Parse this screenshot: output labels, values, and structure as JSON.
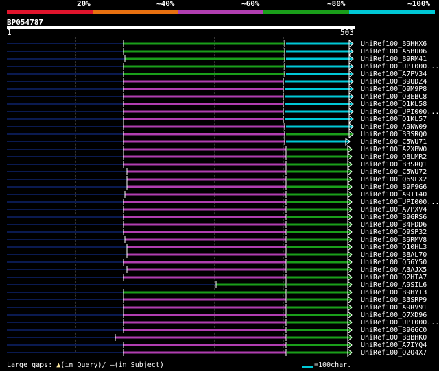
{
  "legend": {
    "colors": [
      "#e0142c",
      "#e87010",
      "#b03eb0",
      "#1a9e1a",
      "#00c8d6"
    ],
    "labels": [
      "20%",
      "~40%",
      "~60%",
      "~80%",
      "~100%"
    ]
  },
  "query": {
    "id": "BP054787",
    "start": "1",
    "end": "503"
  },
  "hits": [
    {
      "label": "UniRef100_B9HHX6",
      "start": 180,
      "mid": 415,
      "end": 515,
      "color": "#00c8d6"
    },
    {
      "label": "UniRef100_A5BU06",
      "start": 180,
      "mid": 415,
      "end": 515,
      "color": "#00c8d6"
    },
    {
      "label": "UniRef100_B9RM41",
      "start": 182,
      "mid": 415,
      "end": 515,
      "color": "#00c8d6"
    },
    {
      "label": "UniRef100_UPI000...",
      "start": 180,
      "mid": 415,
      "end": 515,
      "color": "#00c8d6"
    },
    {
      "label": "UniRef100_A7PV34",
      "start": 180,
      "mid": 415,
      "end": 515,
      "color": "#00c8d6"
    },
    {
      "label": "UniRef100_B9UDZ4",
      "start": 180,
      "mid": 413,
      "end": 515,
      "color": "#00c8d6",
      "mid_color": "#b03eb0"
    },
    {
      "label": "UniRef100_Q9M9P8",
      "start": 180,
      "mid": 413,
      "end": 515,
      "color": "#00c8d6",
      "mid_color": "#b03eb0"
    },
    {
      "label": "UniRef100_Q3EBC8",
      "start": 180,
      "mid": 413,
      "end": 515,
      "color": "#00c8d6",
      "mid_color": "#b03eb0"
    },
    {
      "label": "UniRef100_Q1KL58",
      "start": 180,
      "mid": 413,
      "end": 515,
      "color": "#00c8d6",
      "mid_color": "#b03eb0"
    },
    {
      "label": "UniRef100_UPI000...",
      "start": 180,
      "mid": 413,
      "end": 515,
      "color": "#00c8d6",
      "mid_color": "#b03eb0"
    },
    {
      "label": "UniRef100_Q1KL57",
      "start": 180,
      "mid": 413,
      "end": 515,
      "color": "#00c8d6",
      "mid_color": "#b03eb0"
    },
    {
      "label": "UniRef100_A9NW09",
      "start": 180,
      "mid": 415,
      "end": 515,
      "color": "#00c8d6",
      "mid_color": "#b03eb0"
    },
    {
      "label": "UniRef100_B3SRQ0",
      "start": 180,
      "mid": 415,
      "end": 515,
      "color": "#1a9e1a",
      "mid_color": "#b03eb0"
    },
    {
      "label": "UniRef100_C5WU71",
      "start": 180,
      "mid": 415,
      "end": 510,
      "color": "#00c8d6",
      "mid_color": "#b03eb0"
    },
    {
      "label": "UniRef100_A2XBW0",
      "start": 180,
      "mid": 417,
      "end": 513,
      "color": "#1a9e1a",
      "mid_color": "#b03eb0"
    },
    {
      "label": "UniRef100_Q8LMR2",
      "start": 180,
      "mid": 417,
      "end": 513,
      "color": "#1a9e1a",
      "mid_color": "#b03eb0"
    },
    {
      "label": "UniRef100_B3SRQ1",
      "start": 180,
      "mid": 417,
      "end": 513,
      "color": "#1a9e1a",
      "mid_color": "#b03eb0"
    },
    {
      "label": "UniRef100_C5WU72",
      "start": 185,
      "mid": 417,
      "end": 513,
      "color": "#1a9e1a",
      "mid_color": "#b03eb0"
    },
    {
      "label": "UniRef100_Q69LX2",
      "start": 185,
      "mid": 417,
      "end": 513,
      "color": "#1a9e1a",
      "mid_color": "#b03eb0"
    },
    {
      "label": "UniRef100_B9F9G6",
      "start": 185,
      "mid": 417,
      "end": 513,
      "color": "#1a9e1a",
      "mid_color": "#b03eb0"
    },
    {
      "label": "UniRef100_A9T140",
      "start": 182,
      "mid": 417,
      "end": 513,
      "color": "#1a9e1a",
      "mid_color": "#b03eb0"
    },
    {
      "label": "UniRef100_UPI000...",
      "start": 180,
      "mid": 417,
      "end": 513,
      "color": "#1a9e1a",
      "mid_color": "#b03eb0"
    },
    {
      "label": "UniRef100_A7PXV4",
      "start": 180,
      "mid": 417,
      "end": 513,
      "color": "#1a9e1a",
      "mid_color": "#b03eb0"
    },
    {
      "label": "UniRef100_B9GRS6",
      "start": 180,
      "mid": 417,
      "end": 513,
      "color": "#1a9e1a",
      "mid_color": "#b03eb0"
    },
    {
      "label": "UniRef100_B4FDD6",
      "start": 180,
      "mid": 417,
      "end": 513,
      "color": "#1a9e1a",
      "mid_color": "#b03eb0"
    },
    {
      "label": "UniRef100_Q9SP32",
      "start": 180,
      "mid": 417,
      "end": 513,
      "color": "#1a9e1a",
      "mid_color": "#b03eb0"
    },
    {
      "label": "UniRef100_B9RMV8",
      "start": 182,
      "mid": 417,
      "end": 513,
      "color": "#1a9e1a",
      "mid_color": "#b03eb0"
    },
    {
      "label": "UniRef100_Q10HL3",
      "start": 185,
      "mid": 417,
      "end": 513,
      "color": "#1a9e1a",
      "mid_color": "#b03eb0"
    },
    {
      "label": "UniRef100_B8AL70",
      "start": 185,
      "mid": 417,
      "end": 513,
      "color": "#1a9e1a",
      "mid_color": "#b03eb0"
    },
    {
      "label": "UniRef100_Q56Y50",
      "start": 180,
      "mid": 417,
      "end": 513,
      "color": "#1a9e1a",
      "mid_color": "#b03eb0"
    },
    {
      "label": "UniRef100_A3AJX5",
      "start": 185,
      "mid": 417,
      "end": 513,
      "color": "#1a9e1a",
      "mid_color": "#b03eb0"
    },
    {
      "label": "UniRef100_Q2HTA7",
      "start": 180,
      "mid": 417,
      "end": 513,
      "color": "#1a9e1a",
      "mid_color": "#b03eb0"
    },
    {
      "label": "UniRef100_A9SIL6",
      "start": 315,
      "mid": 417,
      "end": 513,
      "color": "#1a9e1a",
      "mid_color": "#1a9e1a"
    },
    {
      "label": "UniRef100_B9HYI3",
      "start": 180,
      "mid": 417,
      "end": 513,
      "color": "#1a9e1a",
      "mid_color": "#1a9e1a"
    },
    {
      "label": "UniRef100_B3SRP9",
      "start": 180,
      "mid": 417,
      "end": 513,
      "color": "#1a9e1a",
      "mid_color": "#b03eb0"
    },
    {
      "label": "UniRef100_A9RV91",
      "start": 180,
      "mid": 417,
      "end": 513,
      "color": "#1a9e1a",
      "mid_color": "#b03eb0"
    },
    {
      "label": "UniRef100_Q7XD96",
      "start": 180,
      "mid": 417,
      "end": 513,
      "color": "#1a9e1a",
      "mid_color": "#b03eb0"
    },
    {
      "label": "UniRef100_UPI000...",
      "start": 180,
      "mid": 417,
      "end": 513,
      "color": "#1a9e1a",
      "mid_color": "#b03eb0"
    },
    {
      "label": "UniRef100_B9G6C0",
      "start": 180,
      "mid": 417,
      "end": 513,
      "color": "#1a9e1a",
      "mid_color": "#b03eb0"
    },
    {
      "label": "UniRef100_B8BHK0",
      "start": 168,
      "mid": 417,
      "end": 513,
      "color": "#1a9e1a",
      "mid_color": "#b03eb0"
    },
    {
      "label": "UniRef100_A7IYQ4",
      "start": 180,
      "mid": 417,
      "end": 513,
      "color": "#1a9e1a",
      "mid_color": "#b03eb0"
    },
    {
      "label": "UniRef100_Q2Q4X7",
      "start": 180,
      "mid": 417,
      "end": 513,
      "color": "#1a9e1a",
      "mid_color": "#b03eb0"
    }
  ],
  "footer": {
    "gaps_text": "Large gaps:",
    "in_query_text": "(in Query)/",
    "in_subject_text": "(in Subject)",
    "scale_text": "=100char."
  }
}
